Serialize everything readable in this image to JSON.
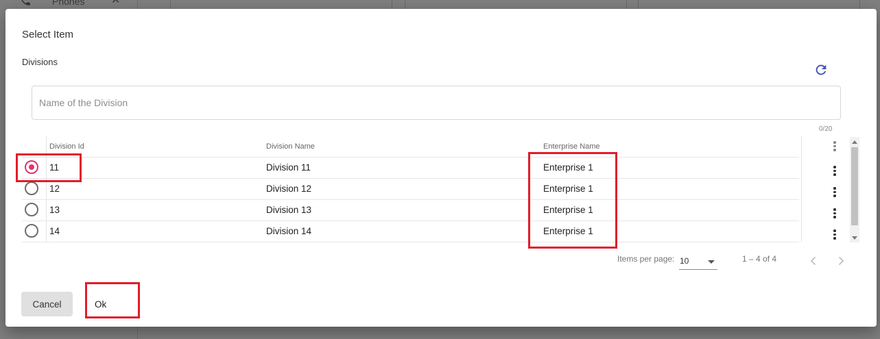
{
  "background": {
    "sidebar_item_label": "Phones"
  },
  "dialog": {
    "title": "Select Item",
    "section_label": "Divisions",
    "search": {
      "placeholder": "Name of the Division",
      "value": "",
      "counter": "0/20"
    },
    "table": {
      "headers": {
        "id": "Division Id",
        "name": "Division Name",
        "enterprise": "Enterprise Name"
      },
      "rows": [
        {
          "id": "11",
          "name": "Division 11",
          "enterprise": "Enterprise 1",
          "selected": true
        },
        {
          "id": "12",
          "name": "Division 12",
          "enterprise": "Enterprise 1",
          "selected": false
        },
        {
          "id": "13",
          "name": "Division 13",
          "enterprise": "Enterprise 1",
          "selected": false
        },
        {
          "id": "14",
          "name": "Division 14",
          "enterprise": "Enterprise 1",
          "selected": false
        }
      ]
    },
    "paginator": {
      "items_per_page_label": "Items per page:",
      "page_size": "10",
      "range_label": "1 – 4 of 4"
    },
    "buttons": {
      "cancel": "Cancel",
      "ok": "Ok"
    }
  },
  "colors": {
    "accent": "#e0336b",
    "refresh_icon": "#3f51b5",
    "highlight": "#e31b2a"
  },
  "icons": {
    "refresh": "refresh-icon",
    "row_menu": "more-vert-icon",
    "prev": "chevron-left-icon",
    "next": "chevron-right-icon",
    "dropdown": "dropdown-caret-icon"
  }
}
